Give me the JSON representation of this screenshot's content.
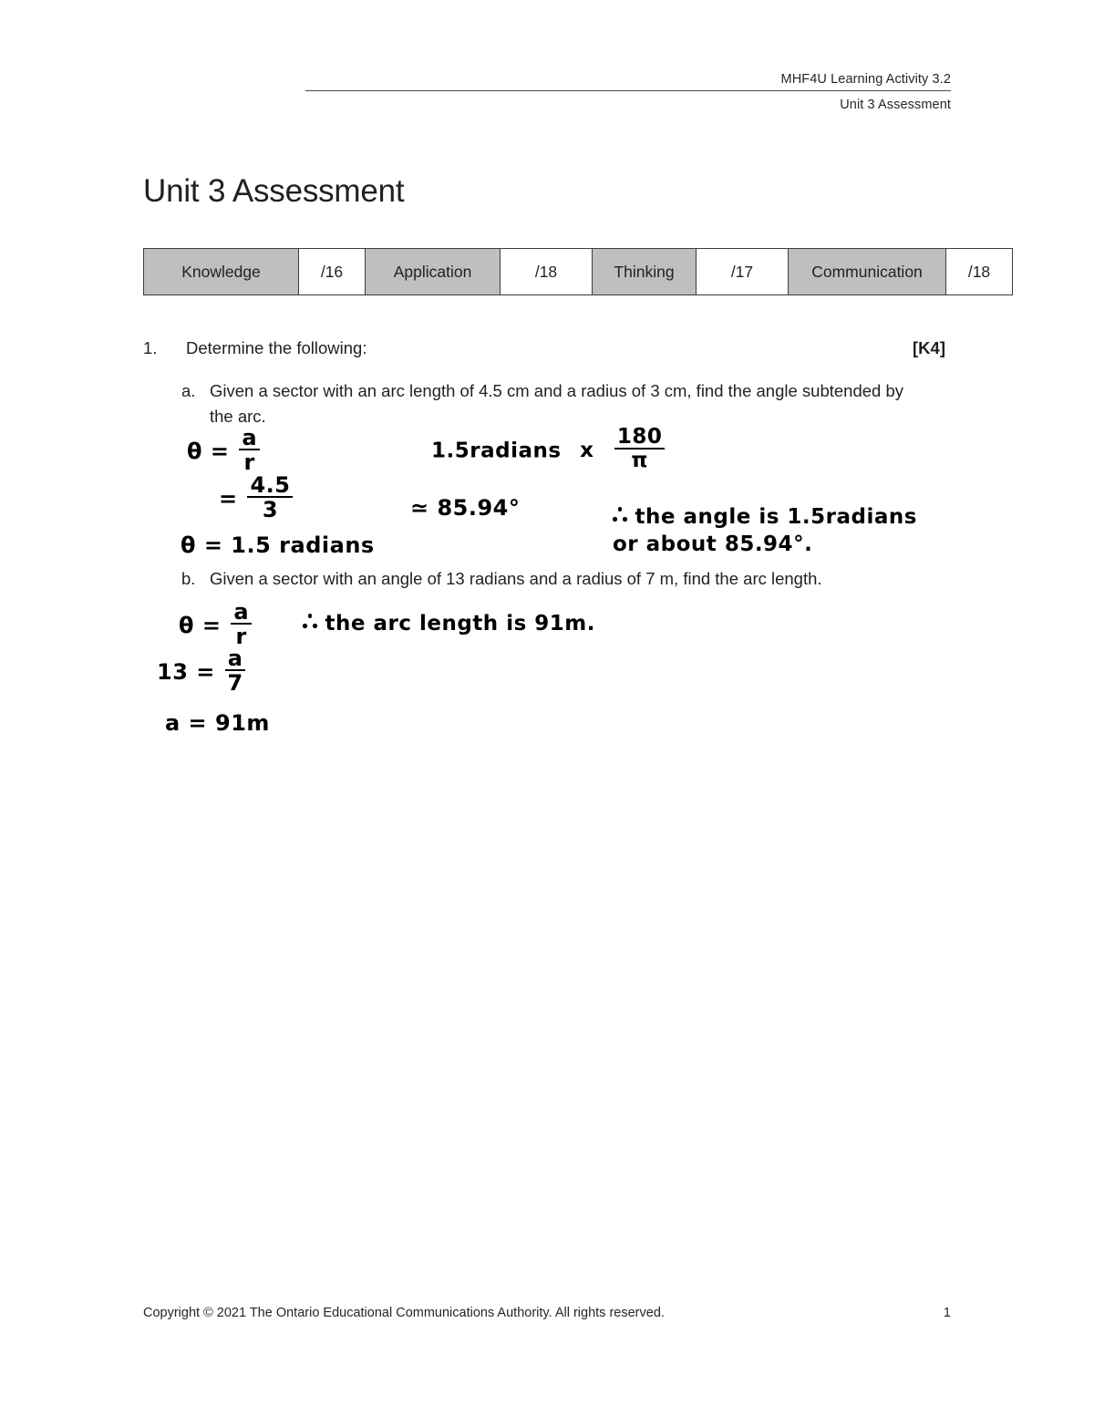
{
  "header": {
    "line1": "MHF4U Learning Activity 3.2",
    "line2": "Unit 3 Assessment"
  },
  "title": "Unit 3 Assessment",
  "marks_table": {
    "cells": [
      {
        "label": "Knowledge",
        "score": "/16"
      },
      {
        "label": "Application",
        "score": "/18"
      },
      {
        "label": "Thinking",
        "score": "/17"
      },
      {
        "label": "Communication",
        "score": "/18"
      }
    ]
  },
  "question": {
    "number": "1.",
    "text": "Determine the following:",
    "code": "[K4]",
    "parts": [
      {
        "label": "a.",
        "text": "Given a sector with an arc length of 4.5 cm and a radius of 3 cm, find the angle subtended by the arc."
      },
      {
        "label": "b.",
        "text": "Given a sector with an angle of 13 radians and a radius of 7 m, find the arc length."
      }
    ]
  },
  "handwriting": {
    "part_a": {
      "line1_lhs": "θ =",
      "line1_num": "a",
      "line1_den": "r",
      "line2_lhs": "=",
      "line2_num": "4.5",
      "line2_den": "3",
      "line3": "θ = 1.5 radians",
      "conv_lhs": "1.5radians",
      "conv_times": "x",
      "conv_num": "180",
      "conv_den": "π",
      "conv_result": "≃ 85.94°",
      "conclusion": "the angle is 1.5radians or about 85.94°."
    },
    "part_b": {
      "line1_lhs": "θ =",
      "line1_num": "a",
      "line1_den": "r",
      "line2_lhs": "13 =",
      "line2_num": "a",
      "line2_den": "7",
      "line3": "a = 91m",
      "conclusion": "the arc length is 91m."
    }
  },
  "footer": {
    "copyright": "Copyright © 2021 The Ontario Educational Communications Authority. All rights reserved.",
    "page_number": "1"
  },
  "colors": {
    "category_cell": "#bfbfbf",
    "text": "#231f20",
    "border": "#3d3d3d"
  }
}
